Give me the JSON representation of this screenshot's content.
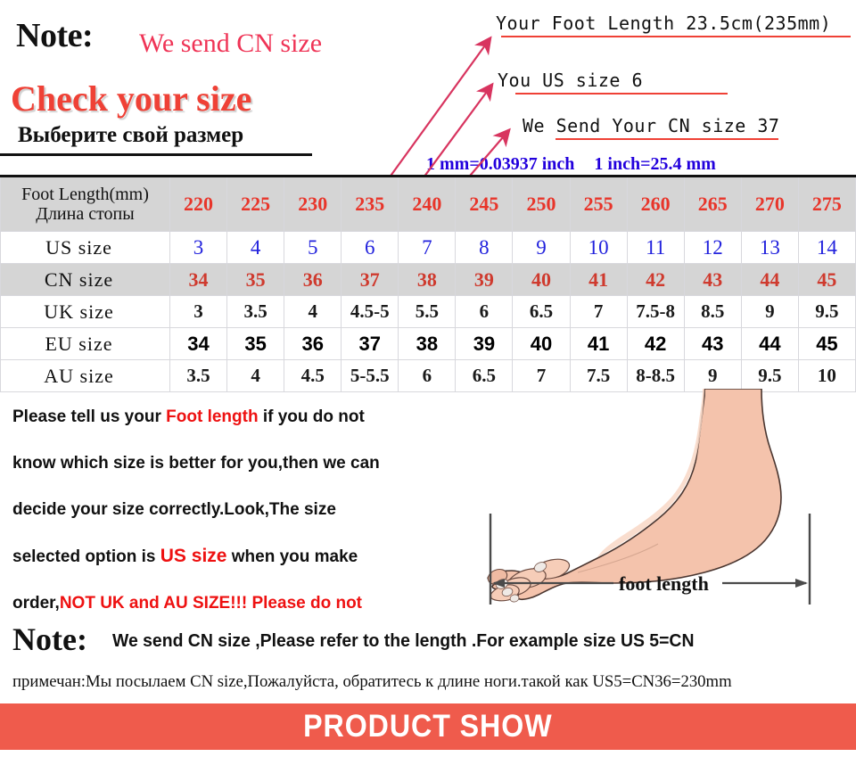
{
  "header": {
    "note_label": "Note:",
    "note_sub": "We send CN size",
    "check_title": "Check your size",
    "check_title_ru": "Выберите свой размер",
    "annotations": [
      "Your Foot Length 23.5cm(235mm)",
      "You US size 6",
      "We Send Your CN size 37"
    ],
    "conversion_1": "1 mm=0.03937 inch",
    "conversion_2": "1 inch=25.4 mm"
  },
  "table": {
    "row_labels": [
      "Foot Length(mm)\nДлина стопы",
      "US size",
      "CN size",
      "UK size",
      "EU size",
      "AU size"
    ],
    "header_label_line1": "Foot Length(mm)",
    "header_label_line2": "Длина стопы",
    "foot_length_mm": [
      "220",
      "225",
      "230",
      "235",
      "240",
      "245",
      "250",
      "255",
      "260",
      "265",
      "270",
      "275"
    ],
    "us_size": [
      "3",
      "4",
      "5",
      "6",
      "7",
      "8",
      "9",
      "10",
      "11",
      "12",
      "13",
      "14"
    ],
    "cn_size": [
      "34",
      "35",
      "36",
      "37",
      "38",
      "39",
      "40",
      "41",
      "42",
      "43",
      "44",
      "45"
    ],
    "uk_size": [
      "3",
      "3.5",
      "4",
      "4.5-5",
      "5.5",
      "6",
      "6.5",
      "7",
      "7.5-8",
      "8.5",
      "9",
      "9.5"
    ],
    "eu_size": [
      "34",
      "35",
      "36",
      "37",
      "38",
      "39",
      "40",
      "41",
      "42",
      "43",
      "44",
      "45"
    ],
    "au_size": [
      "3.5",
      "4",
      "4.5",
      "5-5.5",
      "6",
      "6.5",
      "7",
      "7.5",
      "8-8.5",
      "9",
      "9.5",
      "10"
    ]
  },
  "instructions": {
    "line1_a": "Please tell us your ",
    "line1_red": "Foot length",
    "line1_b": " if you do not",
    "line2": "know which size is better for you,then we can",
    "line3": "decide your size correctly.Look,The size",
    "line4_a": "selected option is  ",
    "line4_red": "US size",
    "line4_b": " when you make",
    "line5_a": "order,",
    "line5_red": "NOT UK and  AU SIZE!!! Please do not"
  },
  "diagram": {
    "caption": "foot length"
  },
  "bottom_note": {
    "label": "Note:",
    "text": "We send CN size ,Please refer to the length .For example size US 5=CN",
    "text_ru": "примечан:Мы посылаем CN size,Пожалуйста, обратитесь к длине ноги.такой как US5=CN36=230mm"
  },
  "banner": {
    "text": "PRODUCT SHOW",
    "color": "#ef5b4c"
  },
  "colors": {
    "red_accent": "#ef4136",
    "blue_accent": "#2222dd",
    "table_red": "#e8352a",
    "header_gray": "#d5d5d5",
    "arrow_pink": "#d8345f"
  }
}
